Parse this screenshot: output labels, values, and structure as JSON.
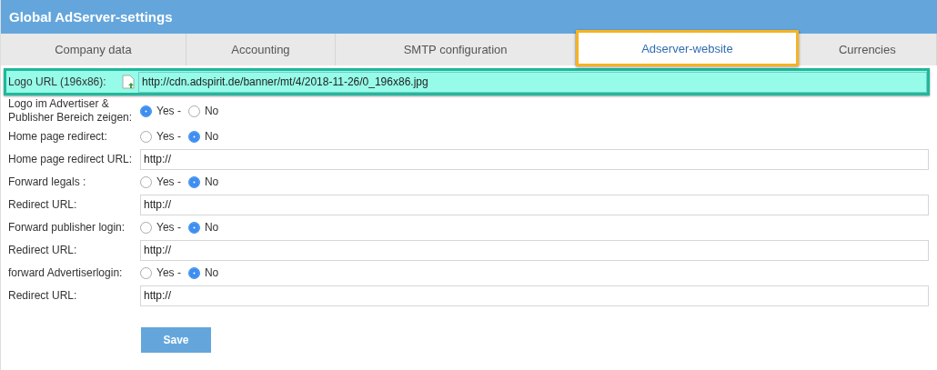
{
  "window": {
    "title": "Global AdServer-settings"
  },
  "tabs": [
    {
      "label": "Company data",
      "selected": false
    },
    {
      "label": "Accounting",
      "selected": false
    },
    {
      "label": "SMTP configuration",
      "selected": false
    },
    {
      "label": "Adserver-website",
      "selected": true
    },
    {
      "label": "Currencies",
      "selected": false
    }
  ],
  "rows": [
    {
      "kind": "file",
      "label": "Logo URL (196x86):",
      "value": "http://cdn.adspirit.de/banner/mt/4/2018-11-26/0_196x86.jpg",
      "highlighted": true
    },
    {
      "kind": "radio",
      "label": "Logo im Advertiser & Publisher Bereich zeigen:",
      "options": [
        {
          "label": "Yes -",
          "selected": true
        },
        {
          "label": "No",
          "selected": false
        }
      ]
    },
    {
      "kind": "radio",
      "label": "Home page redirect:",
      "options": [
        {
          "label": "Yes -",
          "selected": false
        },
        {
          "label": "No",
          "selected": true
        }
      ]
    },
    {
      "kind": "text",
      "label": "Home page redirect URL:",
      "value": "http://"
    },
    {
      "kind": "radio",
      "label": "Forward legals :",
      "options": [
        {
          "label": "Yes -",
          "selected": false
        },
        {
          "label": "No",
          "selected": true
        }
      ]
    },
    {
      "kind": "text",
      "label": "Redirect URL:",
      "value": "http://"
    },
    {
      "kind": "radio",
      "label": "Forward publisher login:",
      "options": [
        {
          "label": "Yes -",
          "selected": false
        },
        {
          "label": "No",
          "selected": true
        }
      ]
    },
    {
      "kind": "text",
      "label": "Redirect URL:",
      "value": "http://"
    },
    {
      "kind": "radio",
      "label": "forward Advertiserlogin:",
      "options": [
        {
          "label": "Yes -",
          "selected": false
        },
        {
          "label": "No",
          "selected": true
        }
      ]
    },
    {
      "kind": "text",
      "label": "Redirect URL:",
      "value": "http://"
    }
  ],
  "buttons": [
    {
      "label": "Save"
    }
  ]
}
